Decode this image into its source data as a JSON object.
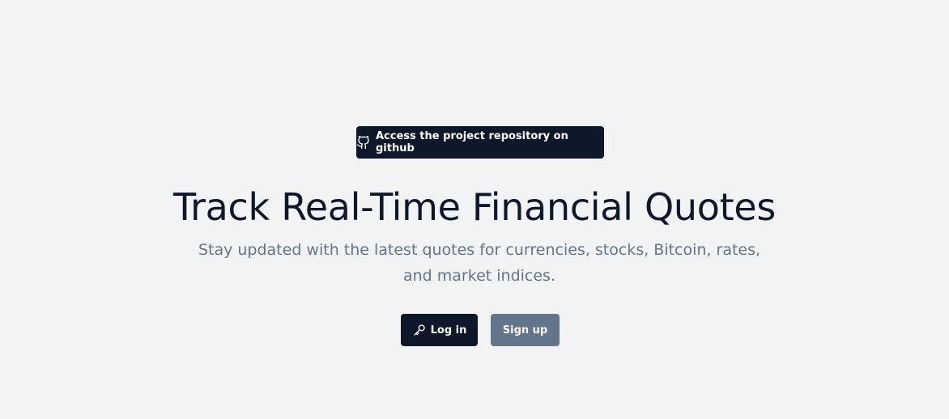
{
  "github_badge": {
    "label": "Access the project repository on github",
    "icon": "github-icon"
  },
  "hero": {
    "title": "Track Real-Time Financial Quotes",
    "subtitle": "Stay updated with the latest quotes for currencies, stocks, Bitcoin, rates, and market indices."
  },
  "actions": {
    "login_label": "Log in",
    "login_icon": "key-icon",
    "signup_label": "Sign up"
  },
  "colors": {
    "background": "#f2f3f5",
    "primary_dark": "#0f172a",
    "secondary_slate": "#64748b",
    "text_muted": "#64748b"
  }
}
